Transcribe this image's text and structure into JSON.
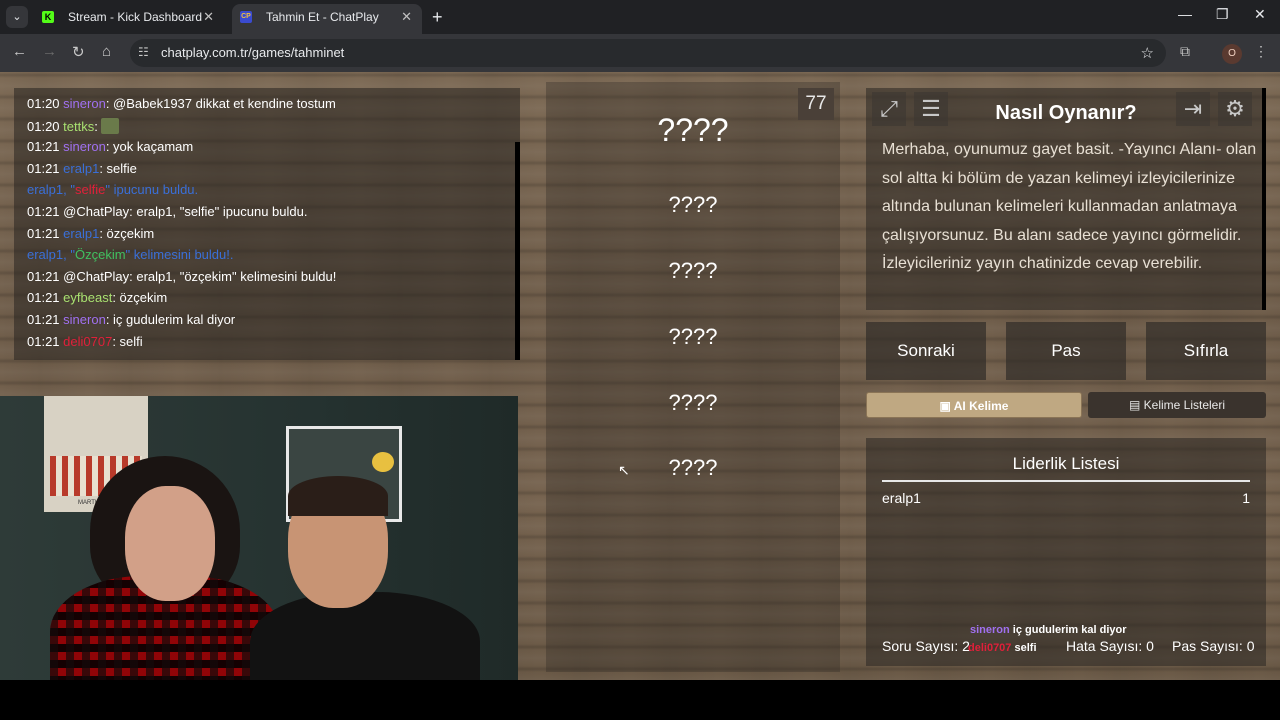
{
  "browser": {
    "tabs": [
      {
        "title": "Stream - Kick Dashboard",
        "favicon": "K"
      },
      {
        "title": "Tahmin Et - ChatPlay",
        "favicon": "CP"
      }
    ],
    "url": "chatplay.com.tr/games/tahminet",
    "profile_initial": "O"
  },
  "chat": {
    "lines": [
      {
        "time": "01:20",
        "user": "sineron",
        "color": "purple",
        "text": ": @Babek1937 dikkat et kendine tostum"
      },
      {
        "time": "01:20",
        "user": "tettks",
        "color": "green",
        "text": ": ",
        "emote": true
      },
      {
        "time": "01:21",
        "user": "sineron",
        "color": "purple",
        "text": ": yok kaçamam"
      },
      {
        "time": "01:21",
        "user": "eralp1",
        "color": "blue",
        "text": ": selfie"
      },
      {
        "system": true,
        "pre": "eralp1, \"",
        "hl": "selfie",
        "hl_color": "red",
        "post": "\" ipucunu buldu."
      },
      {
        "time": "01:21",
        "user": "",
        "text": "@ChatPlay: eralp1, \"selfie\" ipucunu buldu."
      },
      {
        "time": "01:21",
        "user": "eralp1",
        "color": "blue",
        "text": ": özçekim"
      },
      {
        "system": true,
        "pre": "eralp1, \"",
        "hl": "Özçekim",
        "hl_color": "green",
        "post": "\" kelimesini buldu!."
      },
      {
        "time": "01:21",
        "user": "",
        "text": "@ChatPlay: eralp1, \"özçekim\" kelimesini buldu!"
      },
      {
        "time": "01:21",
        "user": "eyfbeast",
        "color": "green",
        "text": ": özçekim"
      },
      {
        "time": "01:21",
        "user": "sineron",
        "color": "purple",
        "text": ": iç gudulerim kal diyor"
      },
      {
        "time": "01:21",
        "user": "deli0707",
        "color": "red",
        "text": ": selfi"
      }
    ]
  },
  "webcam": {
    "poster_text": "MARTINI"
  },
  "game": {
    "counter": "77",
    "main_word": "????",
    "words": [
      "????",
      "????",
      "????",
      "????",
      "????"
    ]
  },
  "info": {
    "title": "Nasıl Oynanır?",
    "description": "Merhaba, oyunumuz gayet basit. -Yayıncı Alanı- olan sol altta ki bölüm de yazan kelimeyi izleyicilerinize altında bulunan kelimeleri kullanmadan anlatmaya çalışıyorsunuz. Bu alanı sadece yayıncı görmelidir. İzleyicileriniz yayın chatinizde cevap verebilir."
  },
  "buttons": {
    "next": "Sonraki",
    "pass": "Pas",
    "reset": "Sıfırla"
  },
  "tabs": {
    "ai": "AI Kelime",
    "lists": "Kelime Listeleri"
  },
  "leaderboard": {
    "title": "Liderlik Listesi",
    "rows": [
      {
        "name": "eralp1",
        "score": "1"
      }
    ],
    "stats": {
      "questions": "Soru Sayısı: 2",
      "errors": "Hata Sayısı: 0",
      "passes": "Pas Sayısı: 0"
    }
  },
  "overlay": {
    "msg1_user": "sineron",
    "msg1_text": "iç gudulerim kal diyor",
    "msg2_user": "deli0707",
    "msg2_text": "selfi"
  },
  "colors": {
    "accent_tab": "#bfa882",
    "purple": "#a070f0",
    "green": "#a8e070",
    "blue": "#3a6fd8",
    "red": "#e0203a"
  }
}
